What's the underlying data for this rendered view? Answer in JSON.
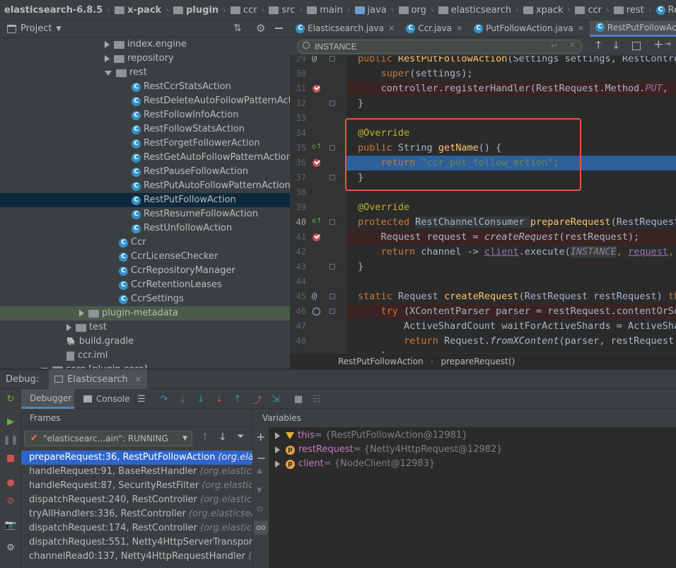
{
  "breadcrumb": [
    "elasticsearch-6.8.5",
    "x-pack",
    "plugin",
    "ccr",
    "src",
    "main",
    "java",
    "org",
    "elasticsearch",
    "xpack",
    "ccr",
    "rest",
    "RestPutFollowAction"
  ],
  "project": {
    "title": "Project",
    "tree": [
      {
        "label": "index.engine",
        "kind": "package",
        "depth": 0,
        "expanded": false
      },
      {
        "label": "repository",
        "kind": "package",
        "depth": 0,
        "expanded": false
      },
      {
        "label": "rest",
        "kind": "package",
        "depth": 0,
        "expanded": true
      },
      {
        "label": "RestCcrStatsAction",
        "kind": "class",
        "depth": 1
      },
      {
        "label": "RestDeleteAutoFollowPatternAction",
        "kind": "class",
        "depth": 1
      },
      {
        "label": "RestFollowInfoAction",
        "kind": "class",
        "depth": 1
      },
      {
        "label": "RestFollowStatsAction",
        "kind": "class",
        "depth": 1
      },
      {
        "label": "RestForgetFollowerAction",
        "kind": "class",
        "depth": 1
      },
      {
        "label": "RestGetAutoFollowPatternAction",
        "kind": "class",
        "depth": 1
      },
      {
        "label": "RestPauseFollowAction",
        "kind": "class",
        "depth": 1
      },
      {
        "label": "RestPutAutoFollowPatternAction",
        "kind": "class",
        "depth": 1
      },
      {
        "label": "RestPutFollowAction",
        "kind": "class",
        "depth": 1,
        "selected": true
      },
      {
        "label": "RestResumeFollowAction",
        "kind": "class",
        "depth": 1
      },
      {
        "label": "RestUnfollowAction",
        "kind": "class",
        "depth": 1
      },
      {
        "label": "Ccr",
        "kind": "class",
        "depth": 0
      },
      {
        "label": "CcrLicenseChecker",
        "kind": "class",
        "depth": 0
      },
      {
        "label": "CcrRepositoryManager",
        "kind": "class",
        "depth": 0
      },
      {
        "label": "CcrRetentionLeases",
        "kind": "class",
        "depth": 0
      },
      {
        "label": "CcrSettings",
        "kind": "class",
        "depth": 0
      },
      {
        "label": "plugin-metadata",
        "kind": "folder",
        "depth": -1,
        "expanded": false,
        "highlighted": true
      },
      {
        "label": "test",
        "kind": "folder",
        "depth": -2,
        "expanded": false
      },
      {
        "label": "build.gradle",
        "kind": "gradle",
        "depth": -2
      },
      {
        "label": "ccr.iml",
        "kind": "iml",
        "depth": -2
      },
      {
        "label": "core [plugin-core]",
        "kind": "folder",
        "depth": -3,
        "expanded": true
      }
    ]
  },
  "editor": {
    "tabs": [
      {
        "label": "Elasticsearch.java",
        "active": false
      },
      {
        "label": "Ccr.java",
        "active": false
      },
      {
        "label": "PutFollowAction.java",
        "active": false
      },
      {
        "label": "RestPutFollowAction.java",
        "active": true
      }
    ],
    "search_value": "INSTANCE",
    "line_numbers": [
      "29",
      "30",
      "31",
      "32",
      "33",
      "34",
      "35",
      "36",
      "37",
      "38",
      "39",
      "40",
      "41",
      "42",
      "43",
      "44",
      "45",
      "46",
      "47",
      "48"
    ],
    "code": {
      "l29a": "public ",
      "l29b": "RestPutFollowAction",
      "l29c": "(Settings settings, RestContro",
      "l30a": "super",
      "l30b": "(settings);",
      "l31a": "controller.registerHandler(RestRequest.Method.",
      "l31b": "PUT",
      "l31c": ",  ",
      "l32": "}",
      "l34": "@Override",
      "l35a": "public ",
      "l35b": "String ",
      "l35c": "getName",
      "l35d": "() {",
      "l36a": "return ",
      "l36b": "\"ccr_put_follow_action\"",
      "l36c": ";",
      "l37": "}",
      "l39": "@Override",
      "l40a": "protected ",
      "l40b": "RestChannelConsumer ",
      "l40c": "prepareRequest",
      "l40d": "(RestRequest",
      "l41a": "Request request = ",
      "l41b": "createRequest",
      "l41c": "(restRequest);",
      "l42a": "return ",
      "l42b": "channel -> ",
      "l42c": "client",
      "l42d": ".execute(",
      "l42e": "INSTANCE",
      "l42f": ", ",
      "l42g": "request",
      "l42h": ", ",
      "l43": "}",
      "l45a": "static ",
      "l45b": "Request ",
      "l45c": "createRequest",
      "l45d": "(RestRequest restRequest) ",
      "l45e": "th",
      "l46a": "try ",
      "l46b": "(XContentParser parser = restRequest.contentOrSo",
      "l47": "ActiveShardCount waitForActiveShards = ActiveSha",
      "l48a": "return ",
      "l48b": "Request.",
      "l48c": "fromXContent",
      "l48d": "(parser, restRequest.p",
      "l49": "}"
    },
    "bottom_crumb": [
      "RestPutFollowAction",
      "prepareRequest()"
    ]
  },
  "debug": {
    "label": "Debug:",
    "session": "Elasticsearch",
    "tabs": [
      "Debugger",
      "Console"
    ],
    "frames_title": "Frames",
    "variables_title": "Variables",
    "thread": "\"elasticsearc...ain\": RUNNING",
    "frames": [
      {
        "method": "prepareRequest:36, RestPutFollowAction",
        "pkg": "(org.elast",
        "selected": true
      },
      {
        "method": "handleRequest:91, BaseRestHandler",
        "pkg": "(org.elasticsea"
      },
      {
        "method": "handleRequest:87, SecurityRestFilter",
        "pkg": "(org.elasticsea"
      },
      {
        "method": "dispatchRequest:240, RestController",
        "pkg": "(org.elasticsea"
      },
      {
        "method": "tryAllHandlers:336, RestController",
        "pkg": "(org.elasticsearc"
      },
      {
        "method": "dispatchRequest:174, RestController",
        "pkg": "(org.elasticsea"
      },
      {
        "method": "dispatchRequest:551, Netty4HttpServerTransport",
        "pkg": "("
      },
      {
        "method": "channelRead0:137, Netty4HttpRequestHandler",
        "pkg": "(org"
      }
    ],
    "variables": [
      {
        "name": "this",
        "value": "= {RestPutFollowAction@12981}",
        "icon": "field-icon"
      },
      {
        "name": "restRequest",
        "value": "= {Netty4HttpRequest@12982}",
        "icon": "param-icon"
      },
      {
        "name": "client",
        "value": "= {NodeClient@12983}",
        "icon": "param-icon"
      }
    ]
  },
  "colors": {
    "accent": "#2f65ca",
    "highlight_box": "#e8563f",
    "exec_line": "#2d6099"
  }
}
